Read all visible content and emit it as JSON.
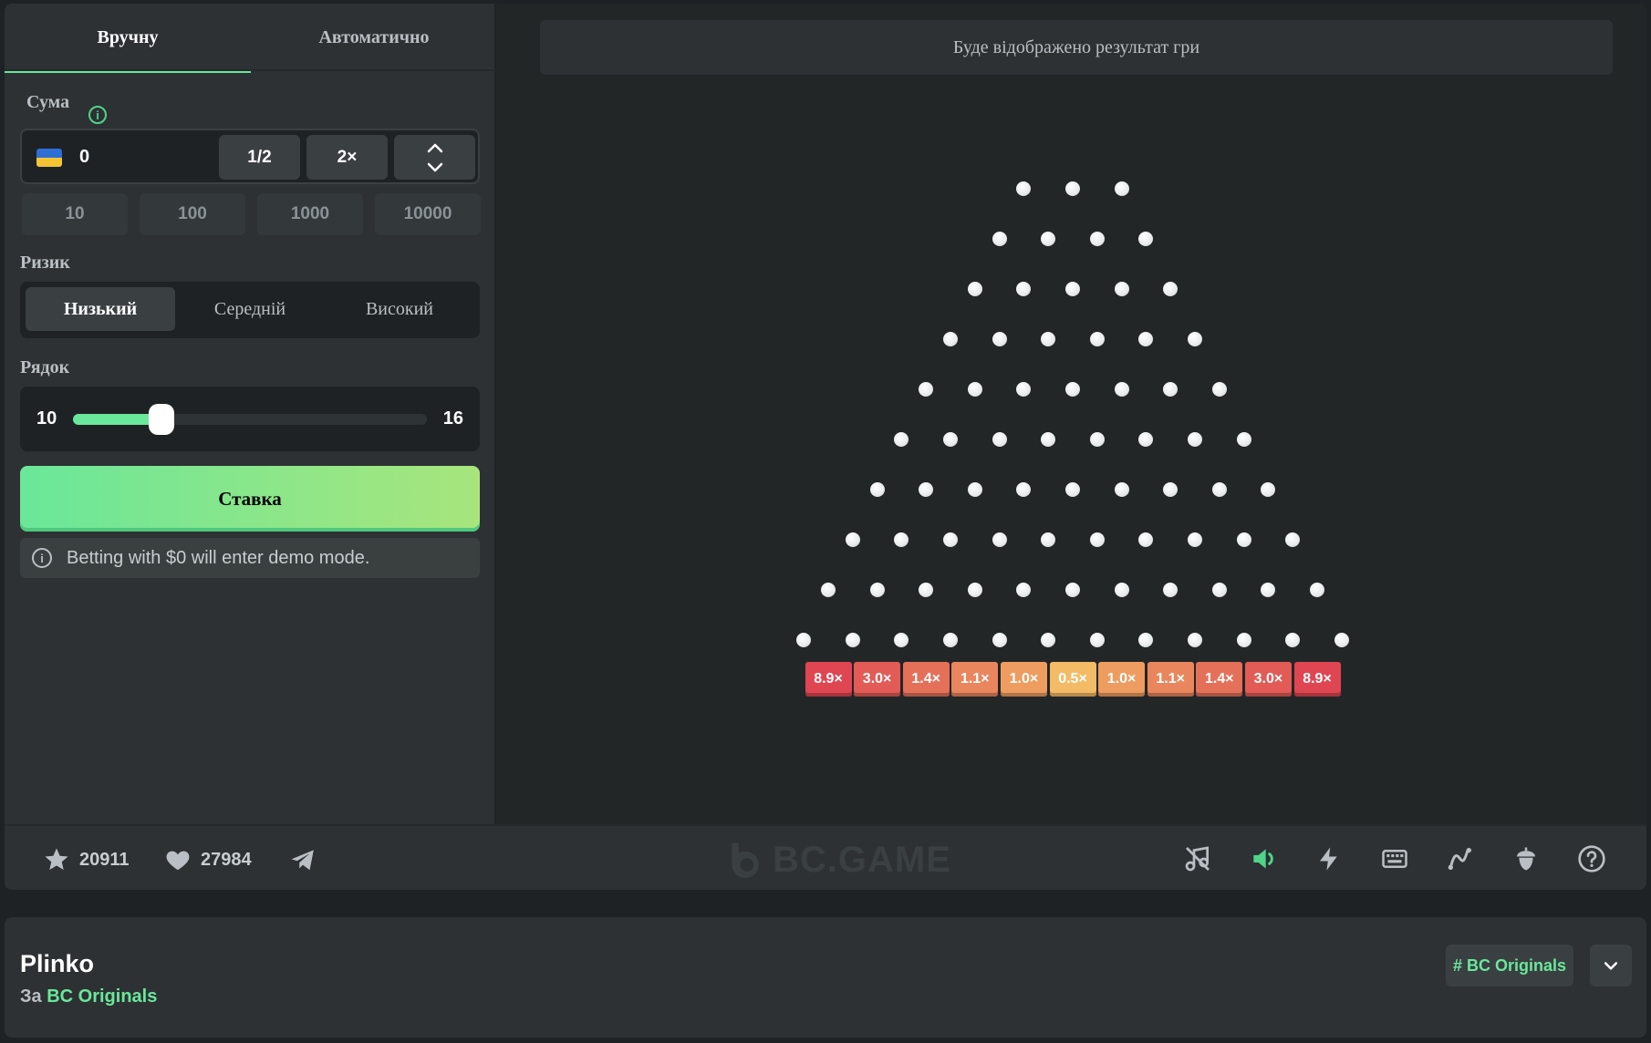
{
  "tabs": {
    "manual": "Вручну",
    "auto": "Автоматично"
  },
  "amount": {
    "label": "Сума",
    "currency_icon": "ukraine-flag-icon",
    "value": "0",
    "half_label": "1/2",
    "double_label": "2×",
    "presets": [
      "10",
      "100",
      "1000",
      "10000"
    ]
  },
  "risk": {
    "label": "Ризик",
    "options": [
      "Низький",
      "Середній",
      "Високий"
    ],
    "selected": "Низький"
  },
  "rows": {
    "label": "Рядок",
    "min": "10",
    "max": "16",
    "value": 10
  },
  "bet_button": "Ставка",
  "demo_note": "Betting with $0 will enter demo mode.",
  "result_text": "Буде відображено результат гри",
  "board": {
    "peg_rows": 10,
    "first_row_pegs": 3,
    "multipliers": [
      "8.9×",
      "3.0×",
      "1.4×",
      "1.1×",
      "1.0×",
      "0.5×",
      "1.0×",
      "1.1×",
      "1.4×",
      "3.0×",
      "8.9×"
    ],
    "bucket_colors": [
      "#e04552",
      "#e25b56",
      "#e5705a",
      "#e9865d",
      "#ee9c5f",
      "#f3bb66",
      "#ee9c5f",
      "#e9865d",
      "#e5705a",
      "#e25b56",
      "#e04552"
    ]
  },
  "footer": {
    "stars": "20911",
    "likes": "27984",
    "logo_text": "BC.GAME",
    "tools": [
      "music-off-icon",
      "sound-icon",
      "lightning-icon",
      "keyboard-icon",
      "route-icon",
      "acorn-icon",
      "help-icon"
    ]
  },
  "game": {
    "title": "Plinko",
    "by_prefix": "За",
    "by_link": "BC Originals",
    "tag": "# BC Originals"
  },
  "colors": {
    "accent": "#6ae79a",
    "panel": "#2d3133",
    "background": "#232627"
  }
}
